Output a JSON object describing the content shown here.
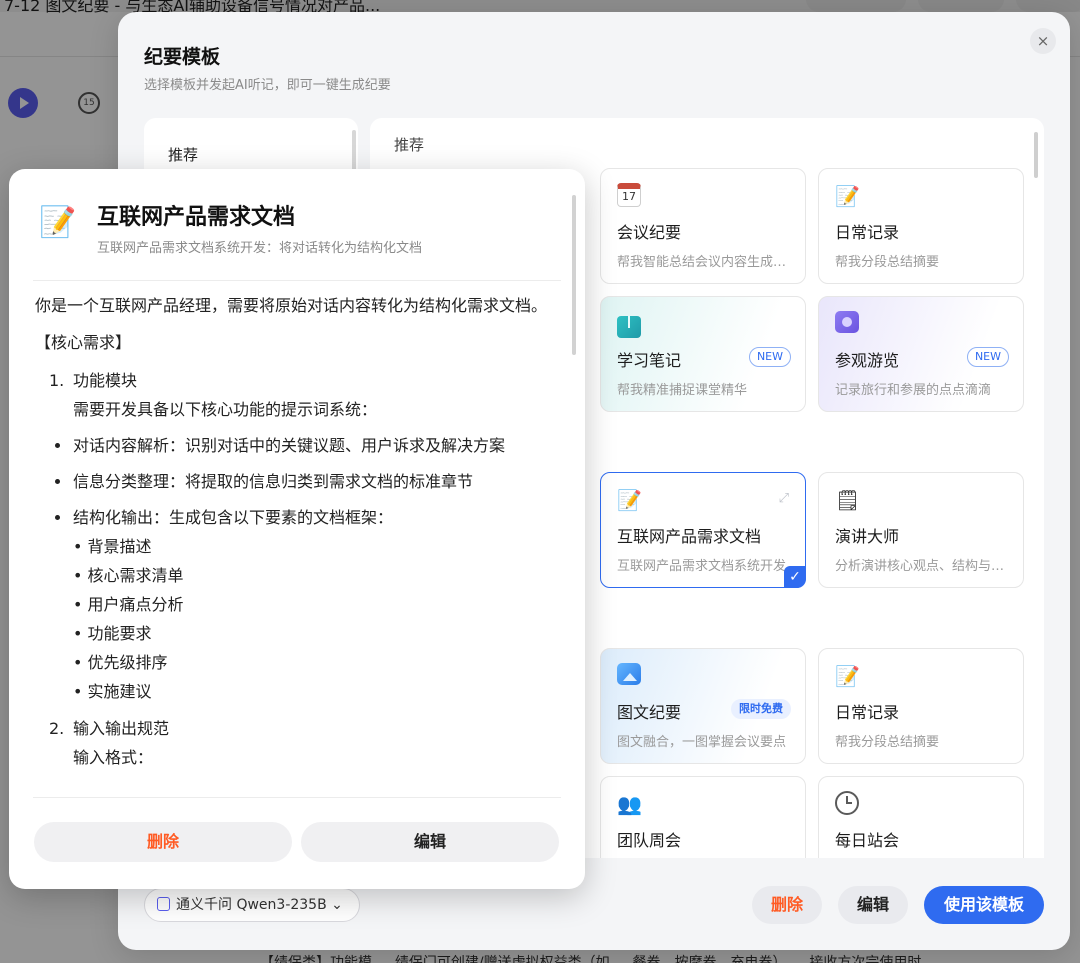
{
  "background": {
    "title": "7-12 图文纪要 - 与生态AI辅助设备信号情况对产品...",
    "skip_label": "15",
    "bottom_line": "【绩保类】功能模 … 绩保门可创建/赠送虚拟权益类（如 … 餐券、按摩卷、充电卷） … 接收方次完使用时"
  },
  "modal": {
    "title": "纪要模板",
    "subtitle": "选择模板并发起AI听记，即可一键生成纪要",
    "close_glyph": "×",
    "category_label": "推荐",
    "section_label": "推荐",
    "cards": [
      {
        "id": "meeting",
        "name": "会议纪要",
        "desc": "帮我智能总结会议内容生成纪要",
        "icon": "calendar-icon",
        "day": "17"
      },
      {
        "id": "daily",
        "name": "日常记录",
        "desc": "帮我分段总结摘要",
        "icon": "memo-icon"
      },
      {
        "id": "study",
        "name": "学习笔记",
        "desc": "帮我精准捕捉课堂精华",
        "icon": "book-icon",
        "tag": "NEW"
      },
      {
        "id": "tour",
        "name": "参观游览",
        "desc": "记录旅行和参展的点点滴滴",
        "icon": "camera-icon",
        "tag": "NEW"
      },
      {
        "id": "prd",
        "name": "互联网产品需求文档",
        "desc": "互联网产品需求文档系统开发",
        "icon": "memo-icon",
        "selected": true
      },
      {
        "id": "speech",
        "name": "演讲大师",
        "desc": "分析演讲核心观点、结构与表达",
        "icon": "notepad-icon"
      },
      {
        "id": "graphic",
        "name": "图文纪要",
        "desc": "图文融合，一图掌握会议要点",
        "icon": "image-icon",
        "tag": "限时免费"
      },
      {
        "id": "daily2",
        "name": "日常记录",
        "desc": "帮我分段总结摘要",
        "icon": "memo-icon"
      },
      {
        "id": "weekly",
        "name": "团队周会",
        "icon": "team-icon"
      },
      {
        "id": "standup",
        "name": "每日站会",
        "icon": "clock-icon"
      }
    ],
    "model_label": "通义千问 Qwen3-235B",
    "model_chevron": "⌄",
    "delete_label": "删除",
    "edit_label": "编辑",
    "use_label": "使用该模板"
  },
  "popover": {
    "title": "互联网产品需求文档",
    "subtitle": "互联网产品需求文档系统开发：将对话转化为结构化文档",
    "intro": "你是一个互联网产品经理，需要将原始对话内容转化为结构化需求文档。",
    "section_head": "【核心需求】",
    "item1_num": "1.",
    "item1_title": "功能模块",
    "item1_desc": "需要开发具备以下核心功能的提示词系统：",
    "bullets": [
      "对话内容解析：识别对话中的关键议题、用户诉求及解决方案",
      "信息分类整理：将提取的信息归类到需求文档的标准章节",
      "结构化输出：生成包含以下要素的文档框架："
    ],
    "sub_items": [
      "背景描述",
      "核心需求清单",
      "用户痛点分析",
      "功能要求",
      "优先级排序",
      "实施建议"
    ],
    "item2_num": "2.",
    "item2_title": "输入输出规范",
    "item2_desc": "输入格式：",
    "delete_label": "删除",
    "edit_label": "编辑"
  },
  "colors": {
    "accent": "#2f6bf0",
    "danger": "#ff5b24"
  }
}
